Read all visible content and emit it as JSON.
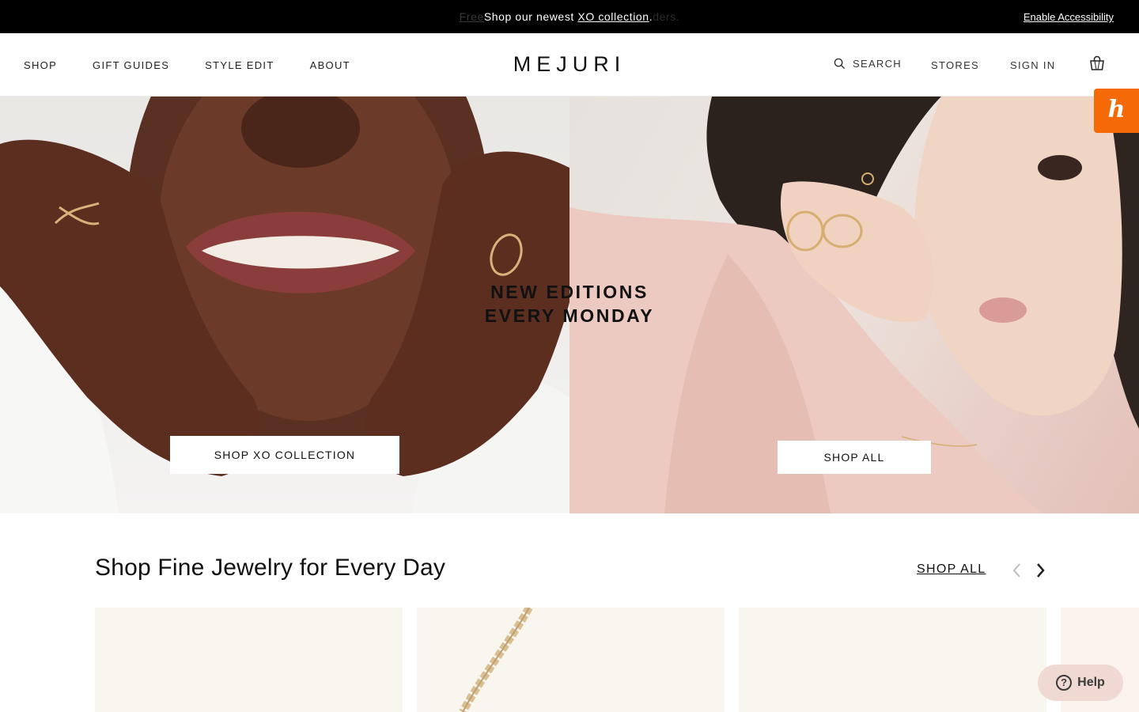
{
  "announcement": {
    "ghost_left": "Free",
    "message_prefix": "Shop our newest ",
    "message_link": "XO collection",
    "message_suffix": ".",
    "ghost_right": "ders.",
    "accessibility": "Enable Accessibility"
  },
  "header": {
    "logo": "MEJURI",
    "nav_left": [
      "SHOP",
      "GIFT GUIDES",
      "STYLE EDIT",
      "ABOUT"
    ],
    "search_label": "SEARCH",
    "stores_label": "STORES",
    "signin_label": "SIGN IN",
    "icons": {
      "search": "search-icon",
      "bag": "shopping-bag-icon"
    }
  },
  "hero": {
    "title_line1": "NEW EDITIONS",
    "title_line2": "EVERY MONDAY",
    "left_button": "SHOP XO COLLECTION",
    "right_button": "SHOP ALL"
  },
  "honey": {
    "glyph": "h",
    "icon": "honey-extension-icon",
    "color": "#f56a07"
  },
  "products": {
    "title": "Shop Fine Jewelry for Every Day",
    "shop_all": "SHOP ALL",
    "icons": {
      "prev": "chevron-left-icon",
      "next": "chevron-right-icon"
    }
  },
  "help": {
    "label": "Help",
    "glyph": "?"
  }
}
